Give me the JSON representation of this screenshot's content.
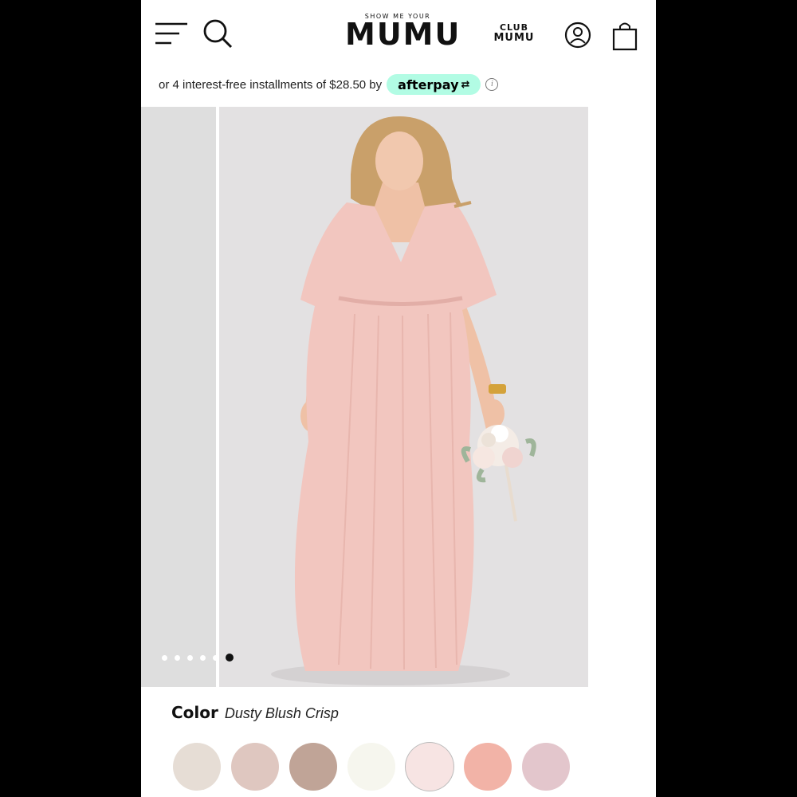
{
  "header": {
    "logo_small": "SHOW ME YOUR",
    "logo_main": "MUMU",
    "club_top": "CLUB",
    "club_bottom": "MUMU",
    "icons": [
      "menu-icon",
      "search-icon",
      "account-icon",
      "shopping-bag-icon"
    ]
  },
  "afterpay": {
    "text": "or 4 interest-free installments of $28.50 by",
    "badge": "afterpay",
    "badge_color": "#b2fce4"
  },
  "gallery": {
    "slide_count": 6,
    "active_slide": 6,
    "background": "#e3e1e2",
    "dress_color": "#f2c6bf"
  },
  "color": {
    "label": "Color",
    "selected_name": "Dusty Blush Crisp",
    "swatches": [
      "#e6ddd5",
      "#dfc7c0",
      "#c0a497",
      "#f6f6ee",
      "#f7e4e3",
      "#f2b3a7",
      "#e3c6cc"
    ]
  }
}
